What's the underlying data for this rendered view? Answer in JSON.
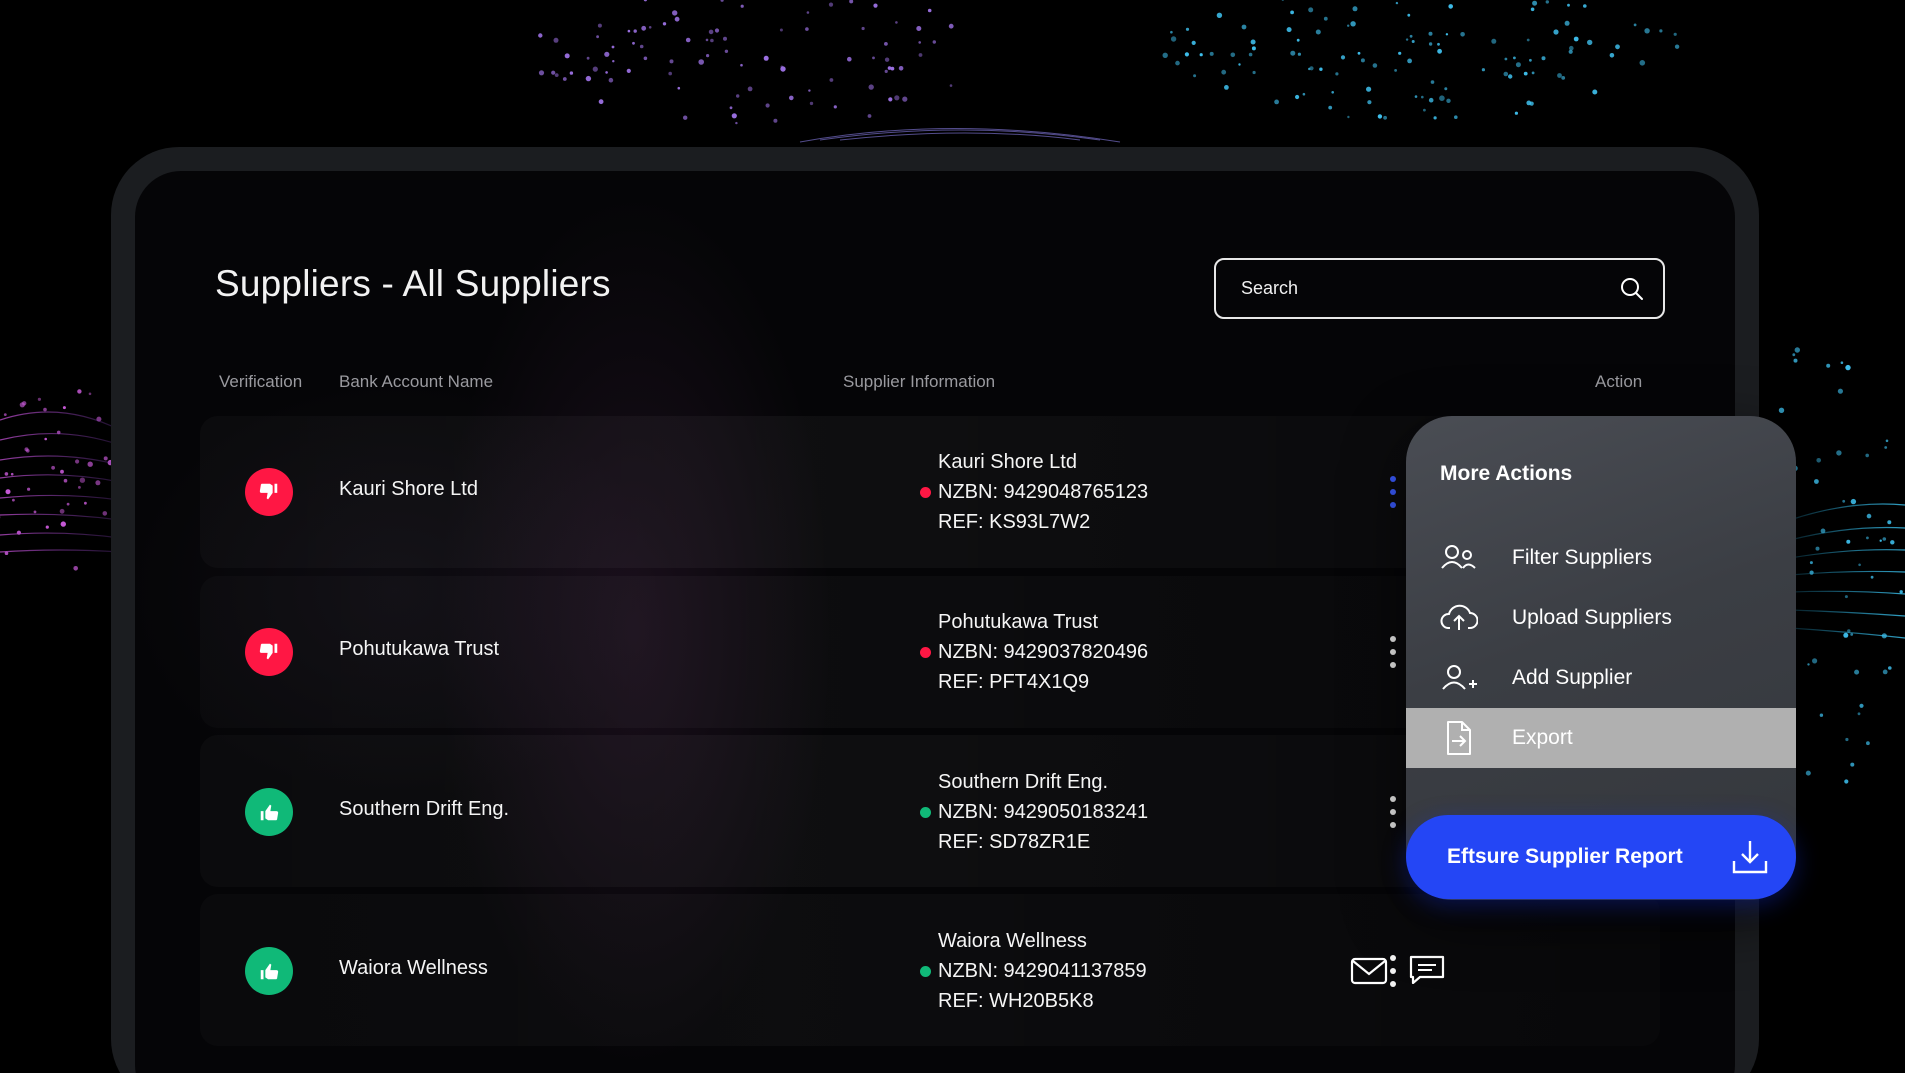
{
  "page": {
    "title": "Suppliers - All Suppliers"
  },
  "search": {
    "placeholder": "Search"
  },
  "table": {
    "headers": {
      "verification": "Verification",
      "bank_account_name": "Bank Account Name",
      "supplier_information": "Supplier Information",
      "action": "Action"
    },
    "rows": [
      {
        "bank_account_name": "Kauri Shore Ltd",
        "verification": "unverified",
        "info_name": "Kauri Shore Ltd",
        "info_nzbn": "NZBN: 9429048765123",
        "info_ref": "REF: KS93L7W2",
        "status_color": "#ff1744"
      },
      {
        "bank_account_name": "Pohutukawa Trust",
        "verification": "unverified",
        "info_name": "Pohutukawa Trust",
        "info_nzbn": "NZBN: 9429037820496",
        "info_ref": "REF: PFT4X1Q9",
        "status_color": "#ff1744"
      },
      {
        "bank_account_name": "Southern Drift Eng.",
        "verification": "verified",
        "info_name": "Southern Drift Eng.",
        "info_nzbn": "NZBN: 9429050183241",
        "info_ref": "REF: SD78ZR1E",
        "status_color": "#10b978"
      },
      {
        "bank_account_name": "Waiora Wellness",
        "verification": "verified",
        "info_name": "Waiora Wellness",
        "info_nzbn": "NZBN: 9429041137859",
        "info_ref": "REF: WH20B5K8",
        "status_color": "#10b978"
      }
    ]
  },
  "more_actions": {
    "title": "More Actions",
    "items": [
      {
        "label": "Filter Suppliers",
        "icon": "users-icon"
      },
      {
        "label": "Upload Suppliers",
        "icon": "cloud-upload-icon"
      },
      {
        "label": "Add Supplier",
        "icon": "add-user-icon"
      },
      {
        "label": "Export",
        "icon": "export-file-icon",
        "selected": true
      }
    ],
    "report_button": "Eftsure Supplier Report"
  },
  "colors": {
    "accent_blue": "#2446f5",
    "unverified_red": "#ff1744",
    "verified_green": "#10b978",
    "menu_bg": "#3b3e44",
    "selected_item": "#b0b0b0"
  }
}
